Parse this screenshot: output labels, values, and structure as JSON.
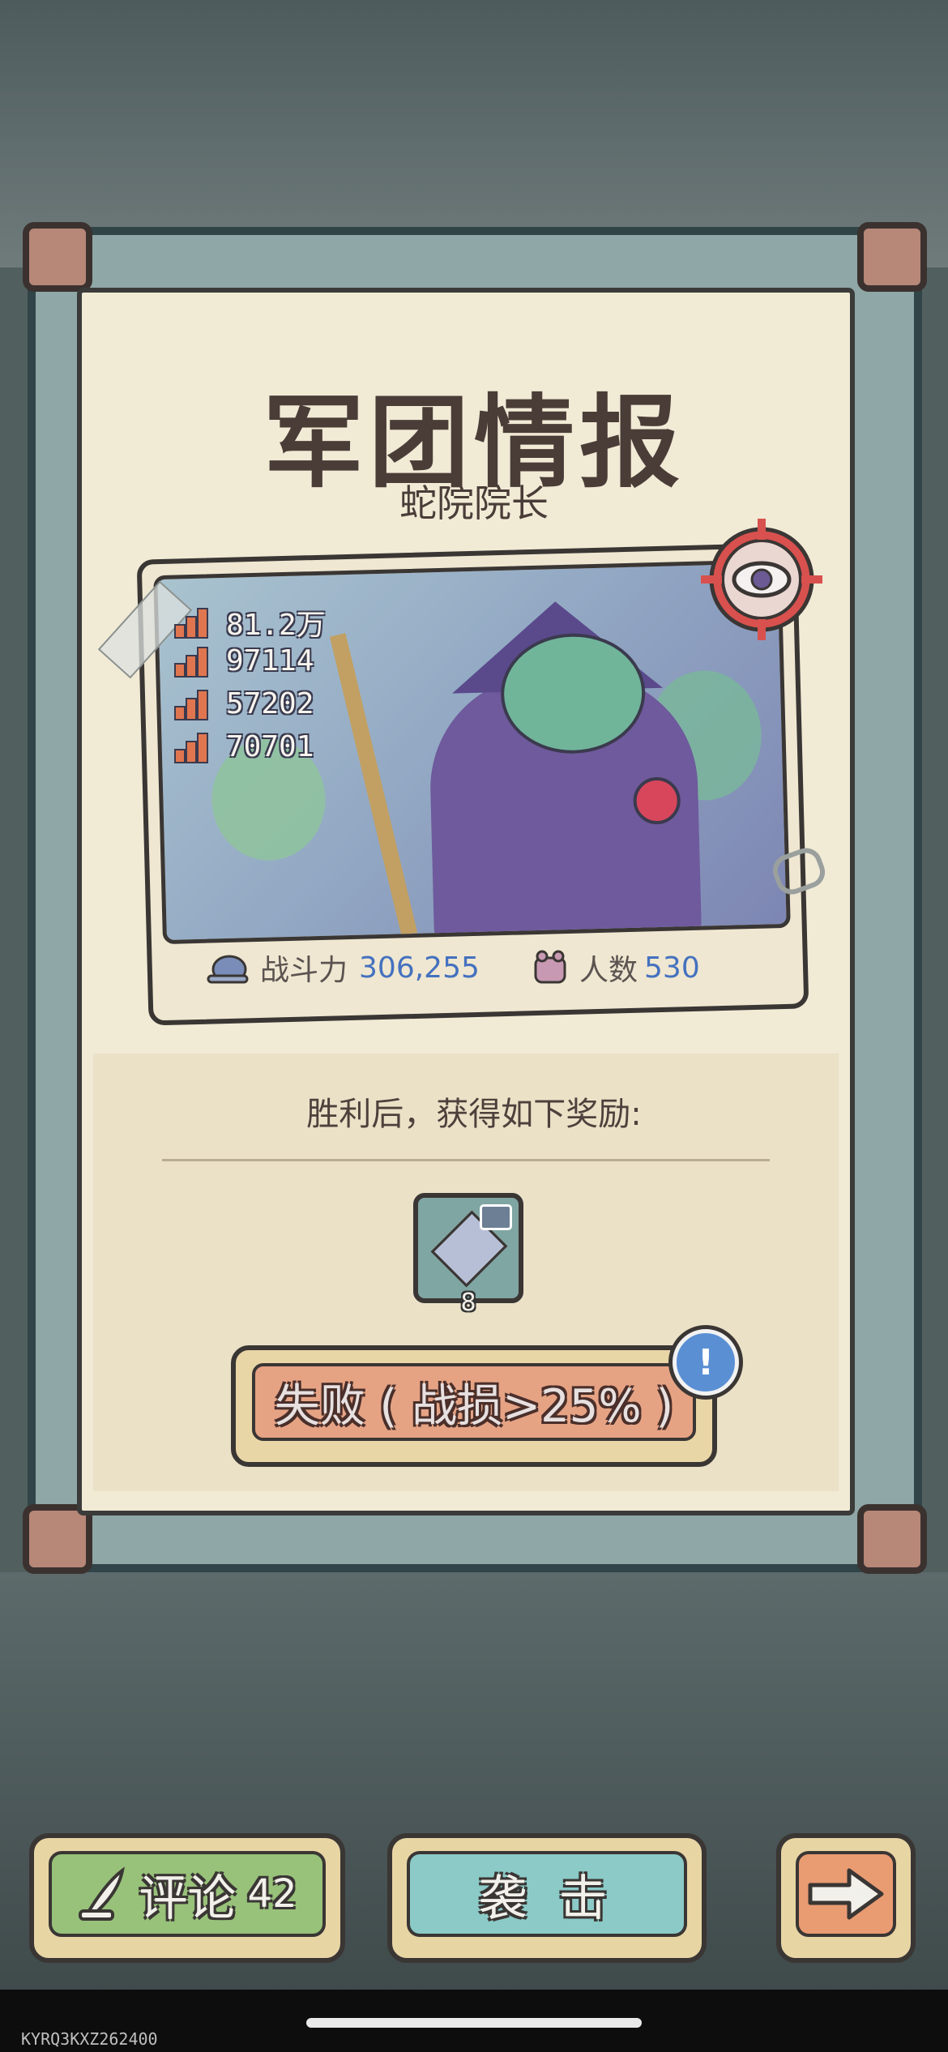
{
  "header": {
    "title": "军团情报",
    "subtitle": "蛇院院长"
  },
  "stats": [
    {
      "icon": "crystal-stat-icon",
      "value": "81.2万"
    },
    {
      "icon": "ore-stat-icon",
      "value": "97114"
    },
    {
      "icon": "gem-stat-icon",
      "value": "57202"
    },
    {
      "icon": "leaf-stat-icon",
      "value": "70701"
    }
  ],
  "summary": {
    "power_label": "战斗力",
    "power_value": "306,255",
    "members_label": "人数",
    "members_value": "530"
  },
  "reward": {
    "text": "胜利后，获得如下奖励:",
    "item_icon": "crystal-item-icon",
    "count": "8"
  },
  "status_button": {
    "label": "失败 ( 战损>25% )",
    "badge": "!"
  },
  "bottom_bar": {
    "comment_label": "评论",
    "comment_count": "42",
    "attack_label": "袭 击"
  },
  "footer": {
    "device_code": "KYRQ3KXZ262400"
  },
  "colors": {
    "paper": "#f1ead5",
    "accent_blue": "#4471bf",
    "fail_button": "#e6a384",
    "comment_button": "#98c27a",
    "attack_button": "#8bcac7",
    "next_button": "#e99b72"
  }
}
